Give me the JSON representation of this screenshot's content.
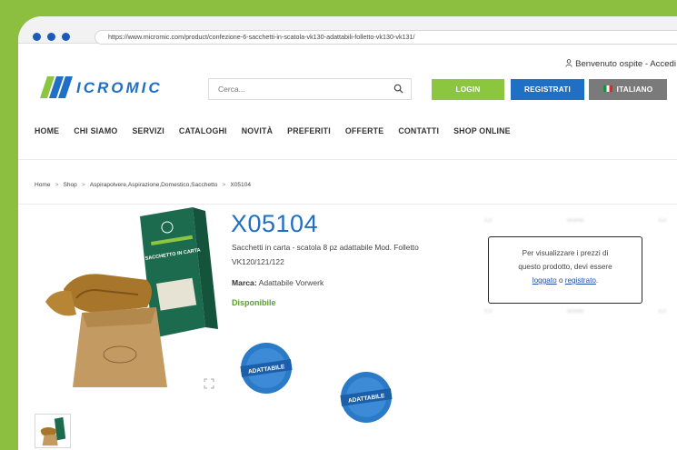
{
  "browser": {
    "url": "https://www.micromic.com/product/confezione-6-sacchetti-in-scatola-vk130-adattabili-folletto-vk130-vk131/"
  },
  "header": {
    "welcome": "Benvenuto ospite - Accedi",
    "logo_alt": "MICROMIC",
    "search_placeholder": "Cerca...",
    "login_label": "LOGIN",
    "register_label": "REGISTRATI",
    "language_label": "ITALIANO"
  },
  "nav": {
    "items": [
      "HOME",
      "CHI SIAMO",
      "SERVIZI",
      "CATALOGHI",
      "NOVITÀ",
      "PREFERITI",
      "OFFERTE",
      "CONTATTI",
      "SHOP ONLINE"
    ]
  },
  "breadcrumb": {
    "items": [
      "Home",
      "Shop",
      "Aspirapolvere,Aspirazione,Domestico,Sacchetto",
      "X05104"
    ]
  },
  "product": {
    "code": "X05104",
    "description": "Sacchetti in carta - scatola 8 pz adattabile Mod. Folletto VK120/121/122",
    "brand_label": "Marca:",
    "brand_value": "Adattabile Vorwerk",
    "availability": "Disponibile",
    "badge_text": "ADATTABILE",
    "box_label": "SACCHETTO IN CARTA"
  },
  "price_notice": {
    "line1": "Per visualizzare i prezzi di",
    "line2": "questo prodotto, devi essere",
    "link1": "loggato",
    "middle": " o ",
    "link2": "registrato",
    "end": "."
  },
  "blurred_prices": {
    "row_top": [
      "0,0",
      "Sconto",
      "0,0"
    ],
    "row_bottom": [
      "0,0",
      "Sconto",
      "0,0"
    ]
  },
  "colors": {
    "accent_green": "#8cc63f",
    "accent_blue": "#1f6fc4",
    "availability_green": "#5aa025"
  }
}
